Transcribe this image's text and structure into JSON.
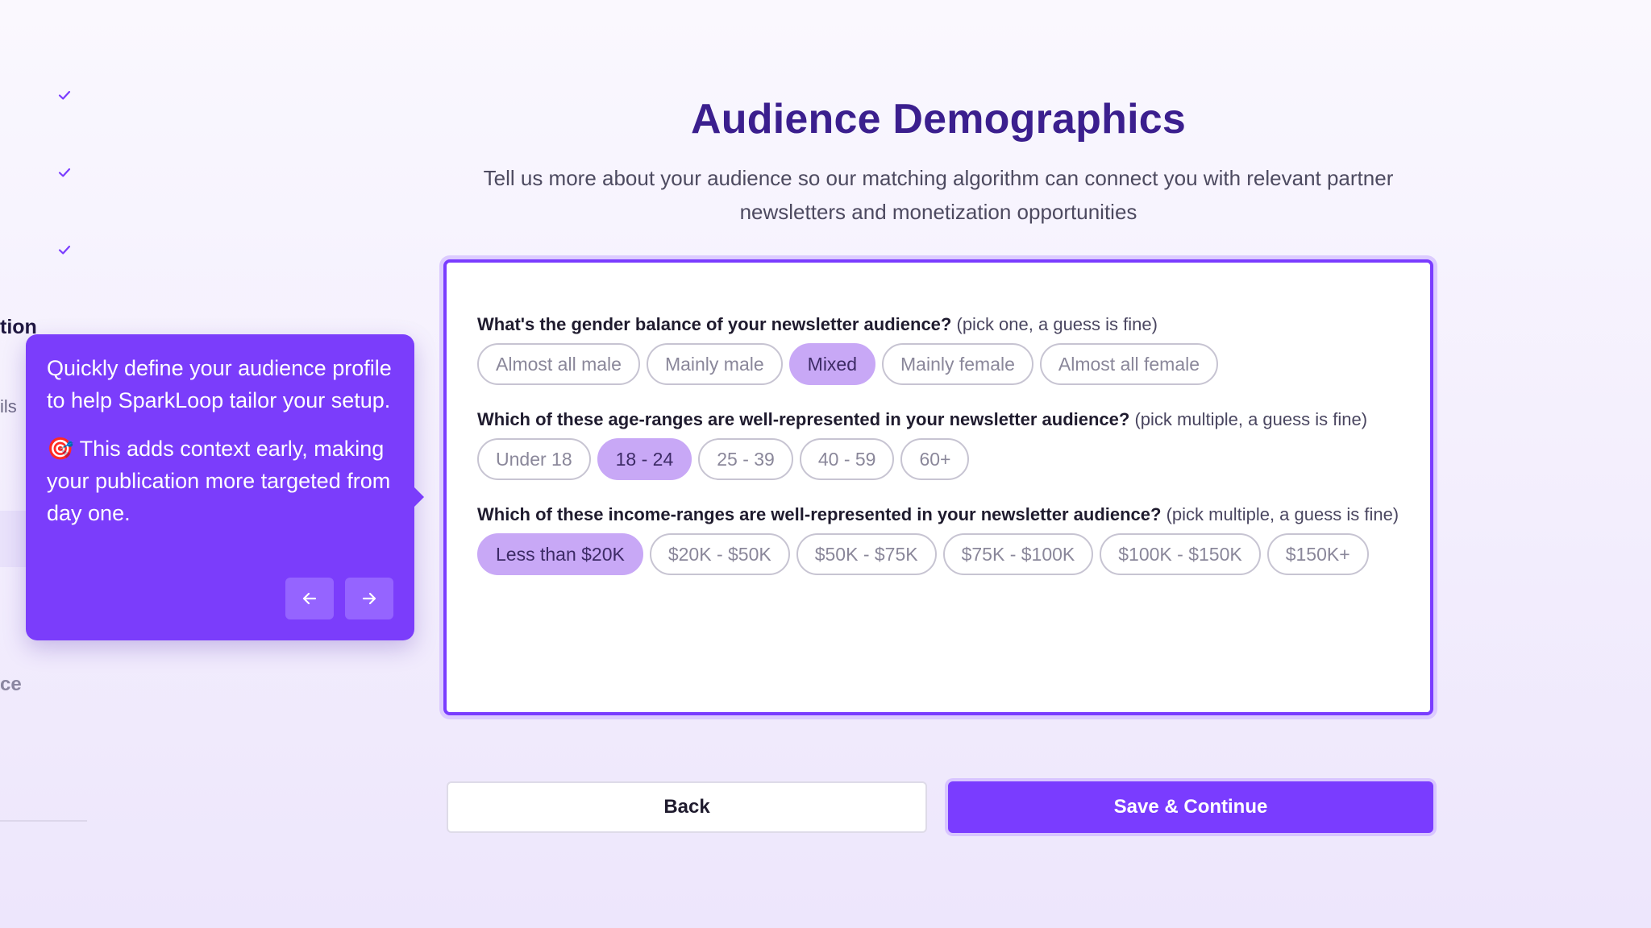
{
  "sidebar": {
    "fragments": {
      "active_step_tail": "tion",
      "step_tail_2": "ils",
      "step_tail_3": "ce"
    }
  },
  "main": {
    "title": "Audience Demographics",
    "subtitle_line1": "Tell us more about your audience so our matching algorithm can connect you with relevant partner",
    "subtitle_line2": "newsletters and monetization opportunities"
  },
  "questions": {
    "gender": {
      "label": "What's the gender balance of your newsletter audience?",
      "hint": "(pick one, a guess is fine)",
      "options": [
        "Almost all male",
        "Mainly male",
        "Mixed",
        "Mainly female",
        "Almost all female"
      ],
      "selected": [
        "Mixed"
      ]
    },
    "age": {
      "label": "Which of these age-ranges are well-represented in your newsletter audience?",
      "hint": "(pick multiple, a guess is fine)",
      "options": [
        "Under 18",
        "18 - 24",
        "25 - 39",
        "40 - 59",
        "60+"
      ],
      "selected": [
        "18 - 24"
      ]
    },
    "income": {
      "label": "Which of these income-ranges are well-represented in your newsletter audience?",
      "hint": "(pick multiple, a guess is fine)",
      "options": [
        "Less than $20K",
        "$20K - $50K",
        "$50K - $75K",
        "$75K - $100K",
        "$100K - $150K",
        "$150K+"
      ],
      "selected": [
        "Less than $20K"
      ]
    }
  },
  "buttons": {
    "back": "Back",
    "save": "Save & Continue"
  },
  "tooltip": {
    "para1": "Quickly define your audience profile to help SparkLoop tailor your setup.",
    "para2": "🎯 This adds context early, making your publication more targeted from day one.",
    "prev_icon": "arrow-left-icon",
    "next_icon": "arrow-right-icon"
  },
  "colors": {
    "accent": "#7a3cff",
    "title": "#3b1f8e",
    "chip_selected": "#c8a8f6",
    "tooltip_bg": "#7b3dfb"
  }
}
